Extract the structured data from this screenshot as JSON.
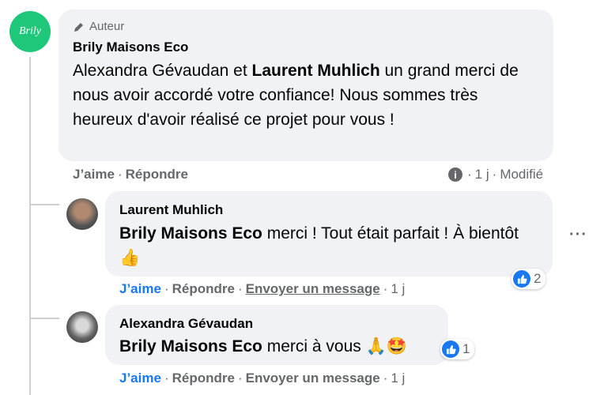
{
  "comment": {
    "author_badge": "Auteur",
    "author": "Brily Maisons Eco",
    "text_1": "Alexandra Gévaudan et ",
    "mention": "Laurent Muhlich",
    "text_2": " un grand merci de nous avoir accordé votre confiance! Nous sommes très heureux d'avoir réalisé ce projet pour vous !",
    "like_label": "J’aime",
    "reply_label": "Répondre",
    "time": "1 j",
    "modified": "Modifié",
    "logo_text": "Brily"
  },
  "replies": [
    {
      "author": "Laurent Muhlich",
      "mention": "Brily Maisons Eco",
      "text": " merci ! Tout était parfait ! À bientôt",
      "emoji": "👍",
      "like_label": "J’aime",
      "reply_label": "Répondre",
      "message_label": "Envoyer un message",
      "time": "1 j",
      "reaction_count": "2"
    },
    {
      "author": "Alexandra Gévaudan",
      "mention": "Brily Maisons Eco",
      "text": " merci à vous ",
      "emoji": "🙏🤩",
      "like_label": "J’aime",
      "reply_label": "Répondre",
      "message_label": "Envoyer un message",
      "time": "1 j",
      "reaction_count": "1"
    }
  ],
  "colors": {
    "accent": "#1877f2",
    "bubble": "#f0f2f5",
    "muted": "#65676b",
    "logo_bg": "#1ec77a"
  },
  "icons": {
    "badge": "pen-icon",
    "info": "info-icon",
    "more": "more-options-icon",
    "like": "thumbs-up-icon"
  }
}
